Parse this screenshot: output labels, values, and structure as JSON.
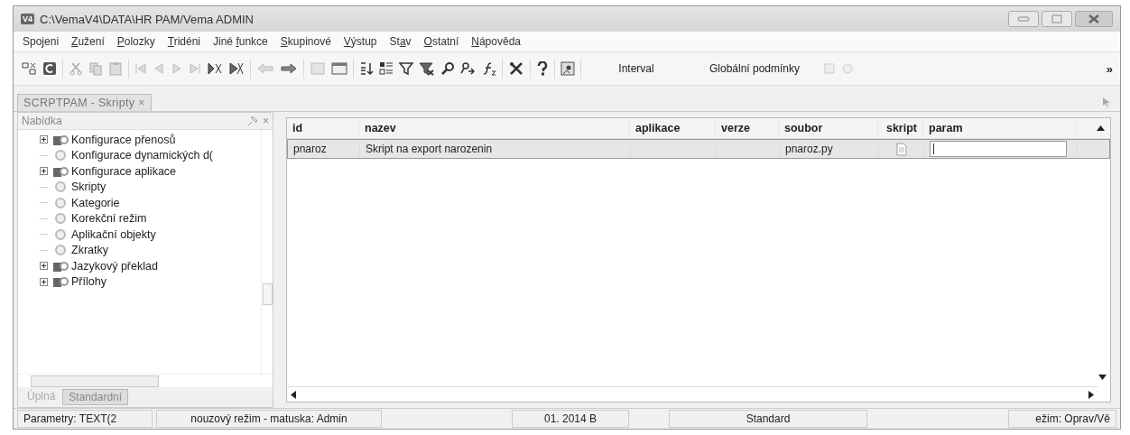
{
  "window": {
    "title": "C:\\VemaV4\\DATA\\HR PAM/Vema ADMIN",
    "logo": "V4"
  },
  "menu": [
    {
      "before": "Spo",
      "accel": "j",
      "after": "eni"
    },
    {
      "accel": "Z",
      "after": "užení"
    },
    {
      "accel": "P",
      "after": "olozky"
    },
    {
      "accel": "T",
      "after": "ridéni"
    },
    {
      "before": "Jiné ",
      "accel": "f",
      "after": "unkce"
    },
    {
      "accel": "S",
      "after": "kupinové"
    },
    {
      "accel": "V",
      "after": "ýstup"
    },
    {
      "before": "St",
      "accel": "a",
      "after": "v"
    },
    {
      "accel": "O",
      "after": "statní"
    },
    {
      "accel": "N",
      "after": "ápověda"
    }
  ],
  "toolbar": {
    "buttons": [
      "Interval",
      "Globální podmínky"
    ],
    "overflow": "»"
  },
  "document_tab": {
    "label": "SCRPTPAM - Skripty",
    "close": "×"
  },
  "sidebar": {
    "title": "Nabídka",
    "close": "×",
    "items": [
      {
        "label": "Konfigurace přenosů",
        "kind": "group"
      },
      {
        "label": "Konfigurace dynamických d(",
        "kind": "item"
      },
      {
        "label": "Konfigurace aplikace",
        "kind": "group"
      },
      {
        "label": "Skripty",
        "kind": "item"
      },
      {
        "label": "Kategorie",
        "kind": "item"
      },
      {
        "label": "Korekční režim",
        "kind": "item"
      },
      {
        "label": "Aplikační objekty",
        "kind": "item"
      },
      {
        "label": "Zkratky",
        "kind": "item"
      },
      {
        "label": "Jazykový překlad",
        "kind": "group"
      },
      {
        "label": "Přílohy",
        "kind": "group"
      }
    ],
    "tabs": [
      {
        "label": "Úplná",
        "selected": false
      },
      {
        "label": "Standardní",
        "selected": true
      }
    ]
  },
  "table": {
    "columns": [
      {
        "label": "id",
        "kind": "text"
      },
      {
        "label": "nazev",
        "kind": "text"
      },
      {
        "label": "aplikace",
        "kind": "text"
      },
      {
        "label": "verze",
        "kind": "text"
      },
      {
        "label": "soubor",
        "kind": "text"
      },
      {
        "label": "skript",
        "kind": "file"
      },
      {
        "label": "param",
        "kind": "input"
      }
    ],
    "rows": [
      {
        "selected": true,
        "cells": [
          "pnaroz",
          "Skript na export narozenin",
          null,
          null,
          "pnaroz.py",
          null,
          null
        ]
      }
    ]
  },
  "status_bar": [
    "Parametry: TEXT(2",
    "nouzový režim - matuska: Admin",
    "01. 2014 B",
    "Standard",
    "ežim: Oprav/Vě"
  ]
}
